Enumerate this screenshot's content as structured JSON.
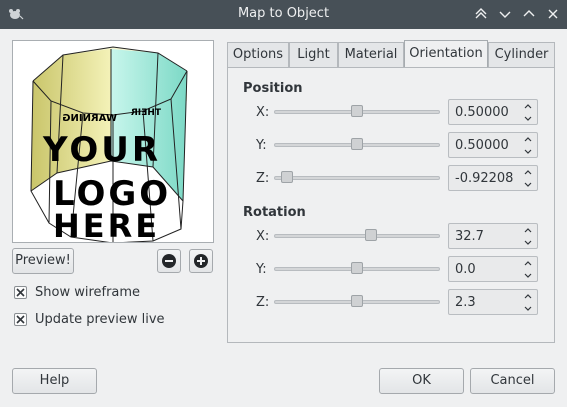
{
  "window": {
    "title": "Map to Object"
  },
  "icons": {
    "app": "mouse-icon",
    "titlebar": [
      "keep-above-icon",
      "minimize-icon",
      "maximize-icon",
      "close-icon"
    ],
    "zoom_out": "zoom-out-icon",
    "zoom_in": "zoom-in-icon"
  },
  "preview": {
    "button_label": "Preview!",
    "image_description_lines": [
      "YOUR",
      "LOGO",
      "HERE"
    ],
    "mirrored_text": [
      "WARNING",
      "THEIR"
    ]
  },
  "options": {
    "show_wireframe": {
      "label": "Show wireframe",
      "checked": true
    },
    "update_preview_live": {
      "label": "Update preview live",
      "checked": true
    }
  },
  "tabs": [
    {
      "label": "Options",
      "active": false
    },
    {
      "label": "Light",
      "active": false
    },
    {
      "label": "Material",
      "active": false
    },
    {
      "label": "Orientation",
      "active": true
    },
    {
      "label": "Cylinder",
      "active": false
    }
  ],
  "orientation": {
    "position": {
      "title": "Position",
      "x": {
        "label": "X:",
        "value": "0.50000",
        "slider_fraction": 0.5
      },
      "y": {
        "label": "Y:",
        "value": "0.50000",
        "slider_fraction": 0.5
      },
      "z": {
        "label": "Z:",
        "value": "-0.92208",
        "slider_fraction": 0.04
      }
    },
    "rotation": {
      "title": "Rotation",
      "x": {
        "label": "X:",
        "value": "32.7",
        "slider_fraction": 0.59
      },
      "y": {
        "label": "Y:",
        "value": "0.0",
        "slider_fraction": 0.5
      },
      "z": {
        "label": "Z:",
        "value": "2.3",
        "slider_fraction": 0.5
      }
    }
  },
  "footer": {
    "help": "Help",
    "ok": "OK",
    "cancel": "Cancel"
  },
  "colors": {
    "titlebar": "#475057",
    "window": "#eff0f1",
    "panel_yellow": "#f2f0a8",
    "panel_cyan": "#aef2e4"
  }
}
